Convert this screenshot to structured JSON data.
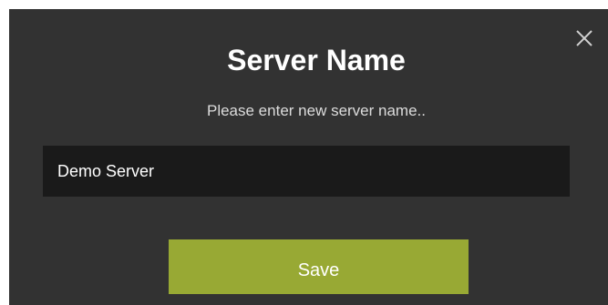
{
  "dialog": {
    "title": "Server Name",
    "subtitle": "Please enter new server name..",
    "close_icon": "close-icon",
    "input": {
      "value": "Demo Server",
      "placeholder": ""
    },
    "save_label": "Save"
  },
  "colors": {
    "dialog_background": "#323232",
    "input_background": "#1a1a1a",
    "save_button": "#98a934",
    "text": "#ffffff"
  }
}
